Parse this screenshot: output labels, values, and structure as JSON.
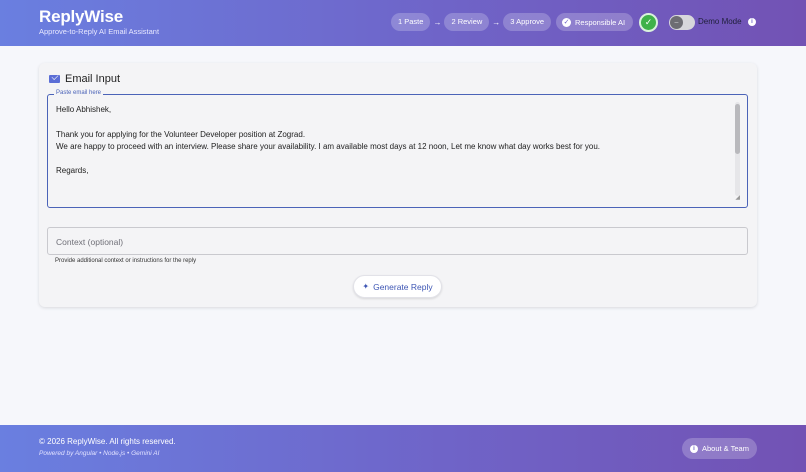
{
  "header": {
    "title": "ReplyWise",
    "subtitle": "Approve-to-Reply AI Email Assistant",
    "steps": [
      "1 Paste",
      "2 Review",
      "3 Approve"
    ],
    "step_arrow": "→",
    "responsible_ai_label": "Responsible AI",
    "demo_mode_label": "Demo Mode",
    "demo_mode_on": false,
    "status_icon": "check-circle-icon",
    "info_icon": "i"
  },
  "card": {
    "title": "Email Input",
    "title_icon": "mail-icon",
    "email_field": {
      "label": "Paste email here",
      "lines": [
        "Hello Abhishek,",
        "",
        "Thank you for applying for the Volunteer Developer position at Zograd.",
        "We are happy to proceed with an interview. Please share your availability. I am available most days at 12 noon, Let me know what day works best for you.",
        "",
        "Regards,"
      ]
    },
    "context_field": {
      "placeholder": "Context (optional)",
      "hint": "Provide additional context or instructions for the reply"
    },
    "generate_button_label": "Generate Reply",
    "generate_icon": "sparkle-icon"
  },
  "footer": {
    "copyright": "© 2026 ReplyWise. All rights reserved.",
    "powered_by": "Powered by Angular • Node.js • Gemini AI",
    "about_label": "About & Team"
  },
  "colors": {
    "header_gradient_start": "#6a7fe0",
    "header_gradient_end": "#7252b4",
    "accent": "#4b63b8",
    "status_green": "#3fb24a"
  }
}
